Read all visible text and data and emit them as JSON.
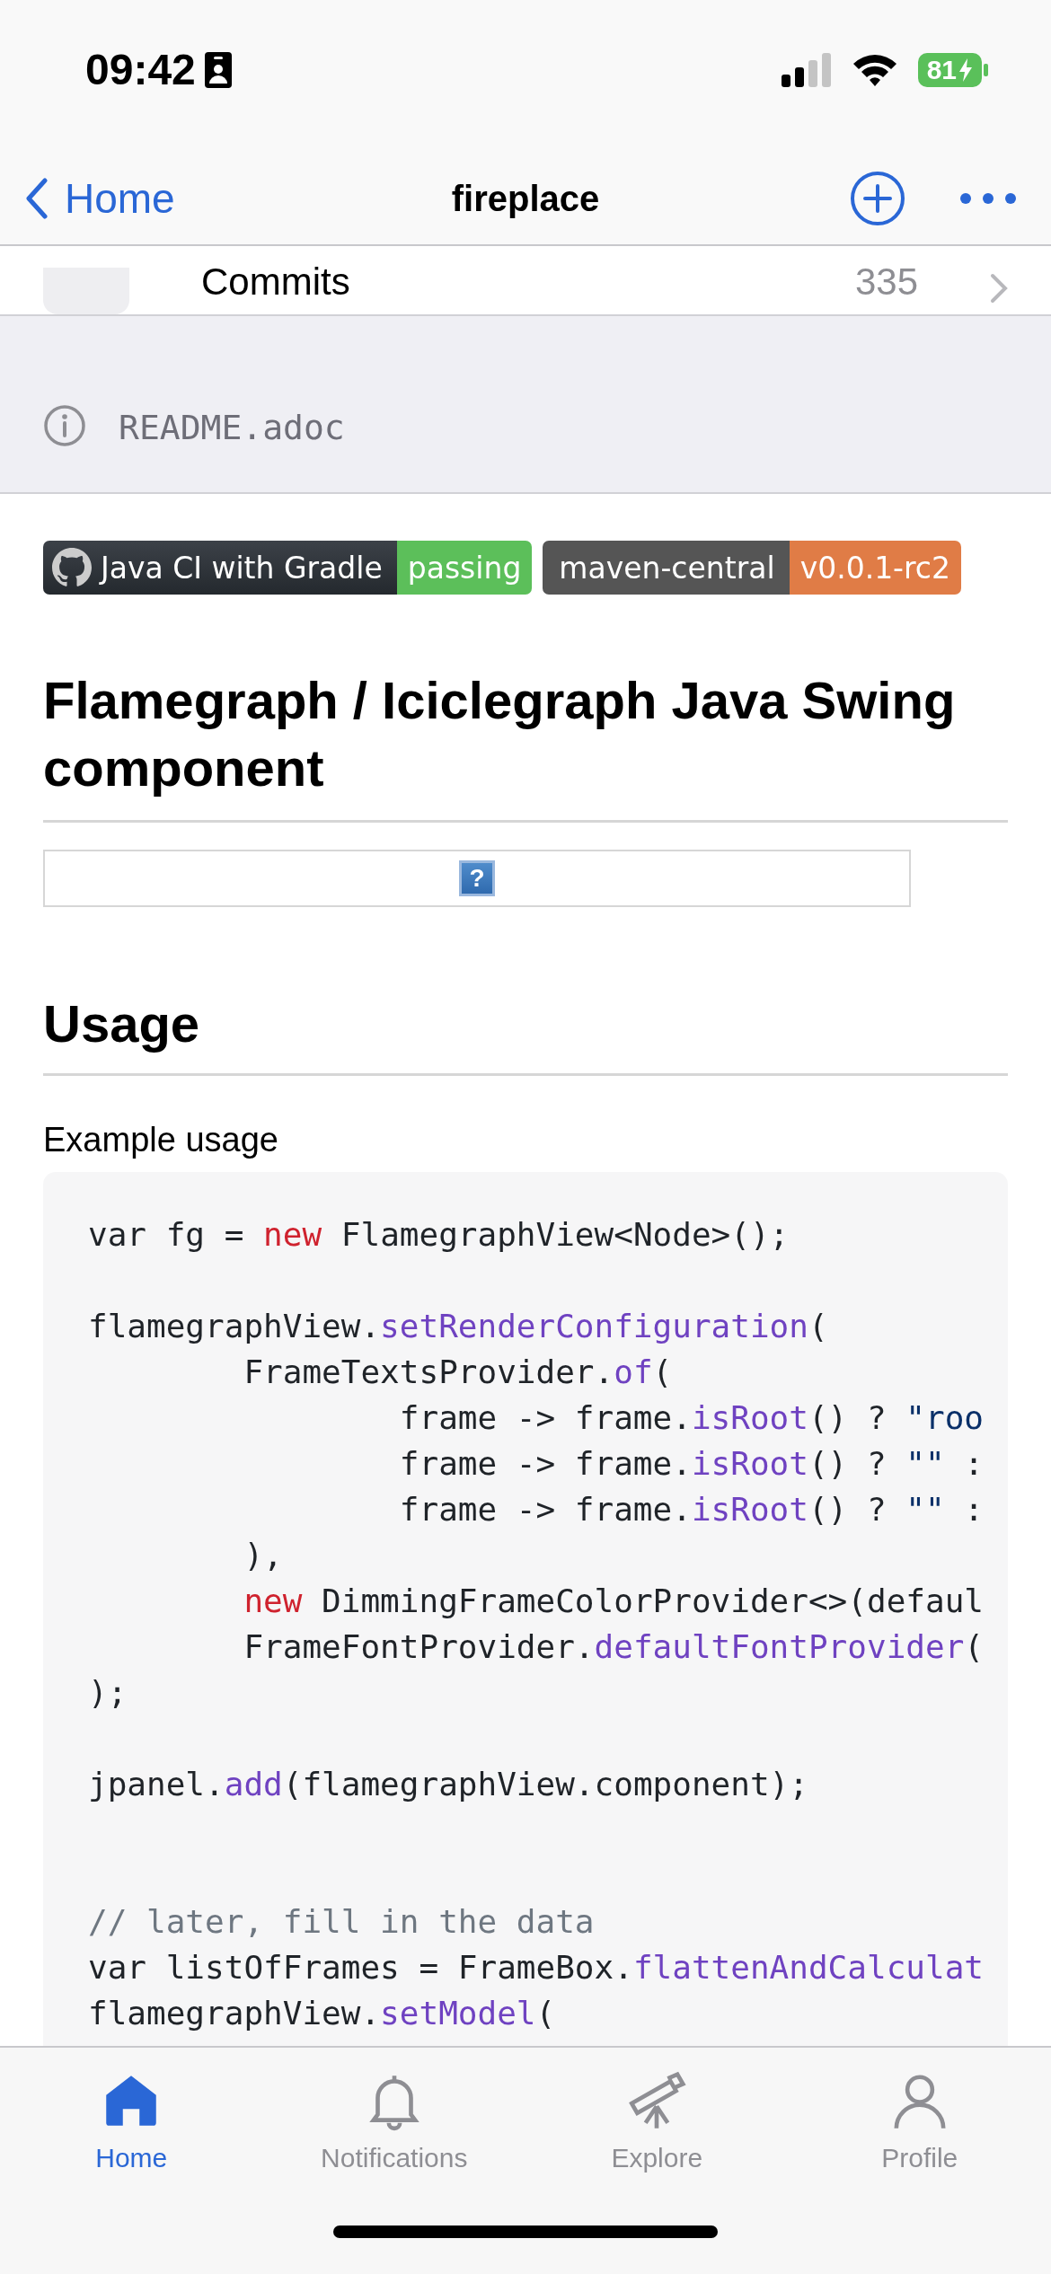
{
  "status_bar": {
    "time": "09:42",
    "battery": "81"
  },
  "nav": {
    "back_label": "Home",
    "title": "fireplace"
  },
  "commits_row": {
    "label": "Commits",
    "count": "335"
  },
  "readme": {
    "file_name": "README.adoc"
  },
  "badges": [
    {
      "kind": "github",
      "label": "Java CI with Gradle",
      "value": "passing",
      "color": "#5cbf5a"
    },
    {
      "kind": "plain",
      "label": "maven-central",
      "value": "v0.0.1-rc2",
      "color": "#e07c46"
    }
  ],
  "heading": "Flamegraph / Iciclegraph Java Swing component",
  "broken_image": {
    "glyph": "?"
  },
  "usage": {
    "heading": "Usage",
    "caption": "Example usage",
    "code_lines": [
      {
        "kind": "code",
        "tokens": [
          {
            "kind": "plain",
            "text": "var fg = "
          },
          {
            "kind": "keyword",
            "text": "new"
          },
          {
            "kind": "plain",
            "text": " FlamegraphView<Node>();"
          }
        ]
      },
      {
        "kind": "blank"
      },
      {
        "kind": "code",
        "tokens": [
          {
            "kind": "plain",
            "text": "flamegraphView."
          },
          {
            "kind": "method",
            "text": "setRenderConfiguration"
          },
          {
            "kind": "plain",
            "text": "("
          }
        ]
      },
      {
        "kind": "code",
        "tokens": [
          {
            "kind": "plain",
            "text": "        FrameTextsProvider."
          },
          {
            "kind": "method",
            "text": "of"
          },
          {
            "kind": "plain",
            "text": "("
          }
        ]
      },
      {
        "kind": "code",
        "tokens": [
          {
            "kind": "plain",
            "text": "                frame -> frame."
          },
          {
            "kind": "method",
            "text": "isRoot"
          },
          {
            "kind": "plain",
            "text": "() ? "
          },
          {
            "kind": "string",
            "text": "\"roo"
          }
        ]
      },
      {
        "kind": "code",
        "tokens": [
          {
            "kind": "plain",
            "text": "                frame -> frame."
          },
          {
            "kind": "method",
            "text": "isRoot"
          },
          {
            "kind": "plain",
            "text": "() ? "
          },
          {
            "kind": "string",
            "text": "\"\""
          },
          {
            "kind": "plain",
            "text": " :"
          }
        ]
      },
      {
        "kind": "code",
        "tokens": [
          {
            "kind": "plain",
            "text": "                frame -> frame."
          },
          {
            "kind": "method",
            "text": "isRoot"
          },
          {
            "kind": "plain",
            "text": "() ? "
          },
          {
            "kind": "string",
            "text": "\"\""
          },
          {
            "kind": "plain",
            "text": " :"
          }
        ]
      },
      {
        "kind": "code",
        "tokens": [
          {
            "kind": "plain",
            "text": "        ),"
          }
        ]
      },
      {
        "kind": "code",
        "indented": true,
        "tokens": [
          {
            "kind": "keyword",
            "text": "new"
          },
          {
            "kind": "plain",
            "text": " DimmingFrameColorProvider<>(defaul"
          }
        ]
      },
      {
        "kind": "code",
        "tokens": [
          {
            "kind": "plain",
            "text": "        FrameFontProvider."
          },
          {
            "kind": "method",
            "text": "defaultFontProvider"
          },
          {
            "kind": "plain",
            "text": "("
          }
        ]
      },
      {
        "kind": "code",
        "tokens": [
          {
            "kind": "plain",
            "text": ");"
          }
        ]
      },
      {
        "kind": "blank"
      },
      {
        "kind": "code",
        "tokens": [
          {
            "kind": "plain",
            "text": "jpanel."
          },
          {
            "kind": "method",
            "text": "add"
          },
          {
            "kind": "plain",
            "text": "(flamegraphView.component);"
          }
        ]
      },
      {
        "kind": "blank"
      },
      {
        "kind": "blank"
      },
      {
        "kind": "code",
        "tokens": [
          {
            "kind": "comment",
            "text": "// later, fill in the data"
          }
        ]
      },
      {
        "kind": "code",
        "tokens": [
          {
            "kind": "plain",
            "text": "var listOfFrames = FrameBox."
          },
          {
            "kind": "method",
            "text": "flattenAndCalculat"
          }
        ]
      },
      {
        "kind": "code",
        "tokens": [
          {
            "kind": "plain",
            "text": "flamegraphView."
          },
          {
            "kind": "method",
            "text": "setModel"
          },
          {
            "kind": "plain",
            "text": "("
          }
        ]
      }
    ]
  },
  "tabs": [
    {
      "kind": "home",
      "label": "Home",
      "selected": true
    },
    {
      "kind": "bell",
      "label": "Notifications",
      "selected": false
    },
    {
      "kind": "telescope",
      "label": "Explore",
      "selected": false
    },
    {
      "kind": "person",
      "label": "Profile",
      "selected": false
    }
  ]
}
